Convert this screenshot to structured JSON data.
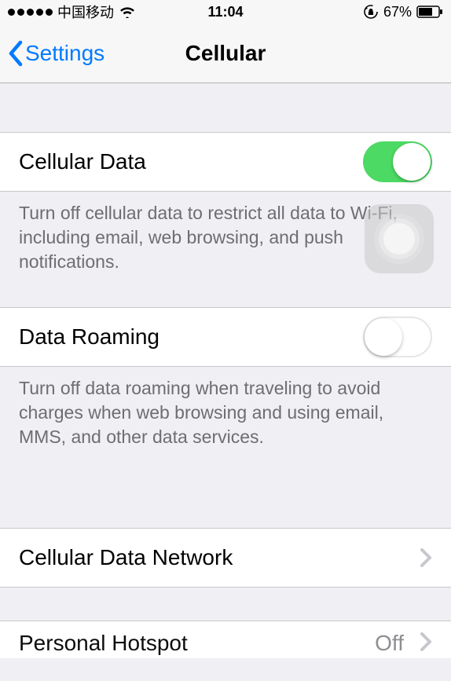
{
  "status_bar": {
    "carrier": "中国移动",
    "time": "11:04",
    "battery_pct": "67%"
  },
  "nav": {
    "back_label": "Settings",
    "title": "Cellular"
  },
  "cells": {
    "cellular_data": {
      "label": "Cellular Data",
      "footer": "Turn off cellular data to restrict all data to Wi-Fi, including email, web browsing, and push notifications.",
      "on": true
    },
    "data_roaming": {
      "label": "Data Roaming",
      "footer": "Turn off data roaming when traveling to avoid charges when web browsing and using email, MMS, and other data services.",
      "on": false
    },
    "cellular_data_network": {
      "label": "Cellular Data Network"
    },
    "personal_hotspot": {
      "label": "Personal Hotspot",
      "value": "Off"
    }
  }
}
